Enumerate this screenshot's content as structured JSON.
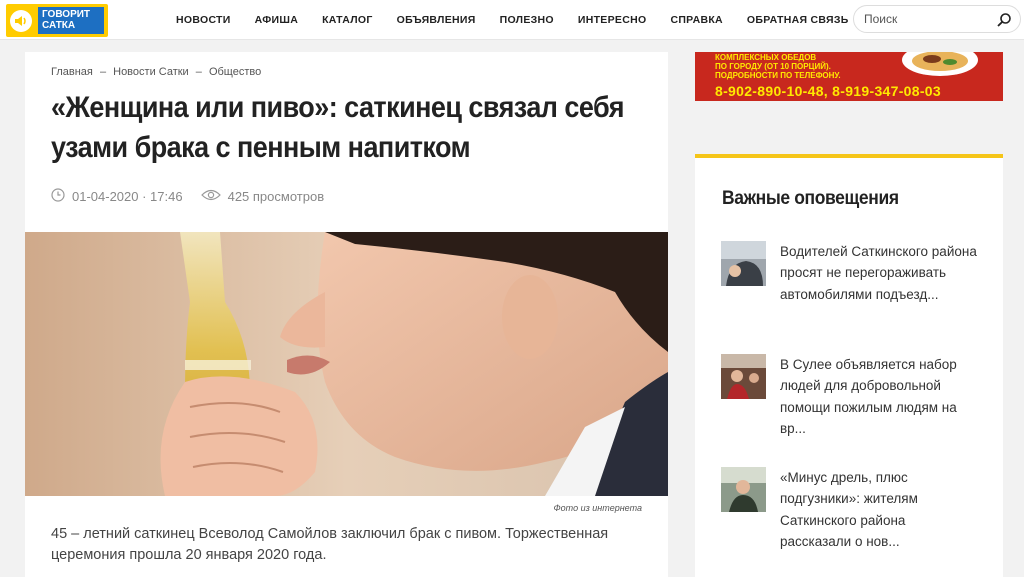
{
  "header": {
    "logo_line1": "ГОВОРИТ",
    "logo_line2": "САТКА",
    "nav": [
      "НОВОСТИ",
      "АФИША",
      "КАТАЛОГ",
      "ОБЪЯВЛЕНИЯ",
      "ПОЛЕЗНО",
      "ИНТЕРЕСНО",
      "СПРАВКА",
      "ОБРАТНАЯ СВЯЗЬ"
    ],
    "search_placeholder": "Поиск"
  },
  "article": {
    "breadcrumb": [
      "Главная",
      "Новости Сатки",
      "Общество"
    ],
    "breadcrumb_sep": "–",
    "title": "«Женщина или пиво»: саткинец связал себя узами брака с пенным напитком",
    "date": "01-04-2020 · 17:46",
    "views": "425 просмотров",
    "photo_caption": "Фото из интернета",
    "lead": "45 – летний саткинец Всеволод Самойлов заключил брак с пивом. Торжественная церемония прошла 20 января 2020 года."
  },
  "banner": {
    "line1": "КОМПЛЕКСНЫХ ОБЕДОВ",
    "line2": "ПО ГОРОДУ (ОТ 10 ПОРЦИЙ).",
    "line3": "ПОДРОБНОСТИ ПО ТЕЛЕФОНУ.",
    "phones": "8-902-890-10-48, 8-919-347-08-03"
  },
  "alerts": {
    "title": "Важные оповещения",
    "items": [
      "Водителей Саткинского района просят не перегораживать автомобилями подъезд...",
      "В Сулее объявляется набор людей для добровольной помощи пожилым людям на вр...",
      "«Минус дрель, плюс подгузники»: жителям Саткинского района рассказали о нов..."
    ]
  },
  "colors": {
    "logo_yellow": "#ffcc00",
    "logo_blue": "#1d6fc2",
    "accent_yellow": "#f5c518",
    "banner_red": "#c8281e"
  }
}
